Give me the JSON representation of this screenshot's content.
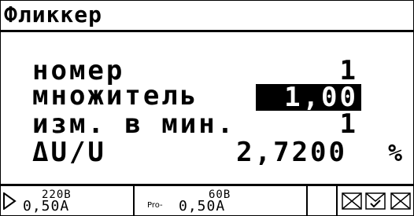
{
  "title": "Фликкер",
  "params": {
    "number": {
      "label": "номер",
      "value": "1"
    },
    "multiplier": {
      "label": "множитель",
      "value": "1,00"
    },
    "per_minute": {
      "label": "изм. в мин.",
      "value": "1"
    },
    "delta_u": {
      "label": "ΔU/U",
      "value": "2,7200",
      "unit": "%"
    }
  },
  "status_bar": {
    "meter1": {
      "icon": "play-icon",
      "voltage": "220В",
      "current": "0,50А"
    },
    "meter2": {
      "prefix": "Pro-",
      "voltage": "60В",
      "current": "0,50А"
    },
    "icons": [
      "envelope-cross-icon",
      "envelope-check-icon",
      "envelope-cross-icon"
    ]
  },
  "colors": {
    "foreground": "#000000",
    "background": "#ffffff",
    "highlight_bg": "#000000",
    "highlight_fg": "#ffffff"
  }
}
